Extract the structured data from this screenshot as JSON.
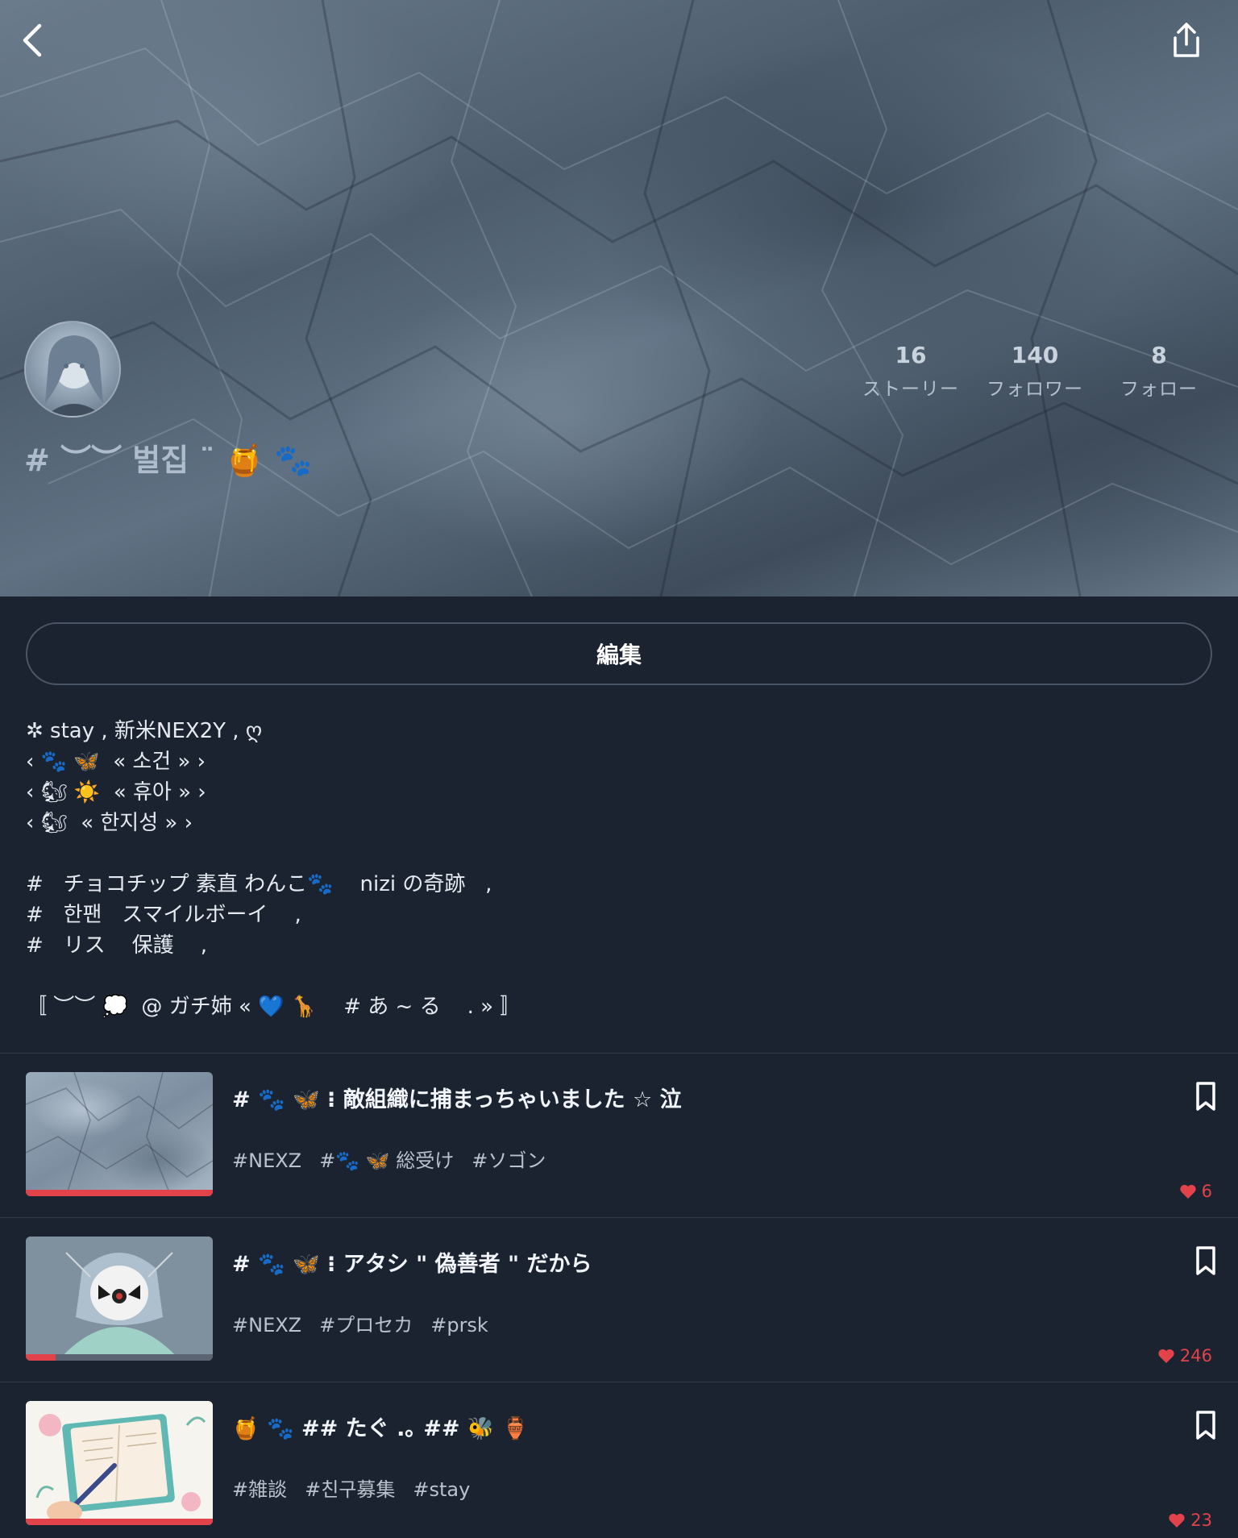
{
  "header": {
    "back_icon": "chevron-left-icon",
    "share_icon": "share-upload-icon"
  },
  "profile": {
    "name": "# ︶︶ 벌집 ¨ 🍯 🐾",
    "stats": [
      {
        "value": "16",
        "label": "ストーリー"
      },
      {
        "value": "140",
        "label": "フォロワー"
      },
      {
        "value": "8",
        "label": "フォロー"
      }
    ]
  },
  "edit_button": {
    "label": "編集"
  },
  "bio": {
    "lines": [
      "✲ stay , 新米NEX2Y , ღ",
      "‹ 🐾 🦋  « 소건 » ›",
      "‹ 🐿 ☀️  « 휴아 » ›",
      "‹ 🐿  « 한지성 » ›",
      "",
      "#   チョコチップ 素直 わんこ🐾    nizi の奇跡   ,",
      "#   한팬   スマイルボーイ    ,",
      "#   リス    保護    ,",
      "",
      "〚 ︶︶ 💭  @ ガチ姉 « 💙 🦒    # あ ~ る    . » 〛"
    ]
  },
  "stories": [
    {
      "title": "# 🐾 🦋  ⁝  敵組織に捕まっちゃいました   ☆   泣",
      "tags": [
        "#NEXZ",
        "#🐾 🦋 総受け",
        "#ソゴン"
      ],
      "likes": "6",
      "progress": 1.0,
      "thumb": "crumpled-paper"
    },
    {
      "title": "# 🐾 🦋  ⁝   アタシ \" 偽善者 \" だから",
      "tags": [
        "#NEXZ",
        "#プロセカ",
        "#prsk"
      ],
      "likes": "246",
      "progress": 0.16,
      "thumb": "anime-character"
    },
    {
      "title": "🍯  🐾 ## たぐ .｡ ## 🐝 🏺",
      "tags": [
        "#雑談",
        "#친구募集",
        "#stay"
      ],
      "likes": "23",
      "progress": 1.0,
      "thumb": "notebook-illustration"
    }
  ],
  "colors": {
    "background": "#1b2330",
    "accent_red": "#e2434b",
    "divider": "#323c4b"
  }
}
